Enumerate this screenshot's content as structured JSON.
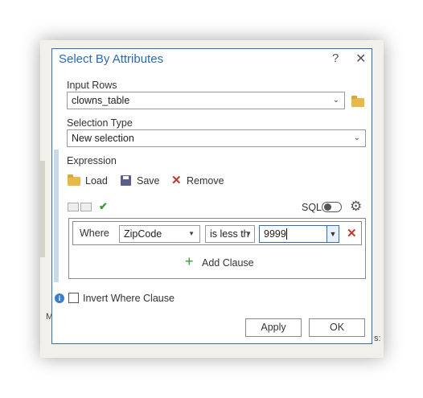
{
  "dialog": {
    "title": "Select By Attributes",
    "help_glyph": "?",
    "close_glyph": "✕"
  },
  "input_rows": {
    "label": "Input Rows",
    "value": "clowns_table"
  },
  "selection_type": {
    "label": "Selection Type",
    "value": "New selection"
  },
  "expression": {
    "label": "Expression",
    "load_label": "Load",
    "save_label": "Save",
    "remove_label": "Remove",
    "sql_label": "SQL",
    "sql_enabled": false
  },
  "clause": {
    "where_label": "Where",
    "field": "ZipCode",
    "operator": "is less th",
    "value": "9999",
    "add_clause_label": "Add Clause"
  },
  "invert": {
    "label": "Invert Where Clause",
    "checked": false
  },
  "buttons": {
    "apply": "Apply",
    "ok": "OK"
  },
  "background": {
    "map_edge_text_left": "M",
    "map_edge_text_right": "s:"
  },
  "colors": {
    "accent": "#2a6ab0",
    "remove": "#c0392b",
    "check": "#3c9a3c"
  },
  "icons": [
    "folder-icon",
    "save-icon",
    "close-icon",
    "check-icon",
    "gear-icon",
    "plus-icon",
    "info-icon",
    "chevron-down-icon"
  ]
}
